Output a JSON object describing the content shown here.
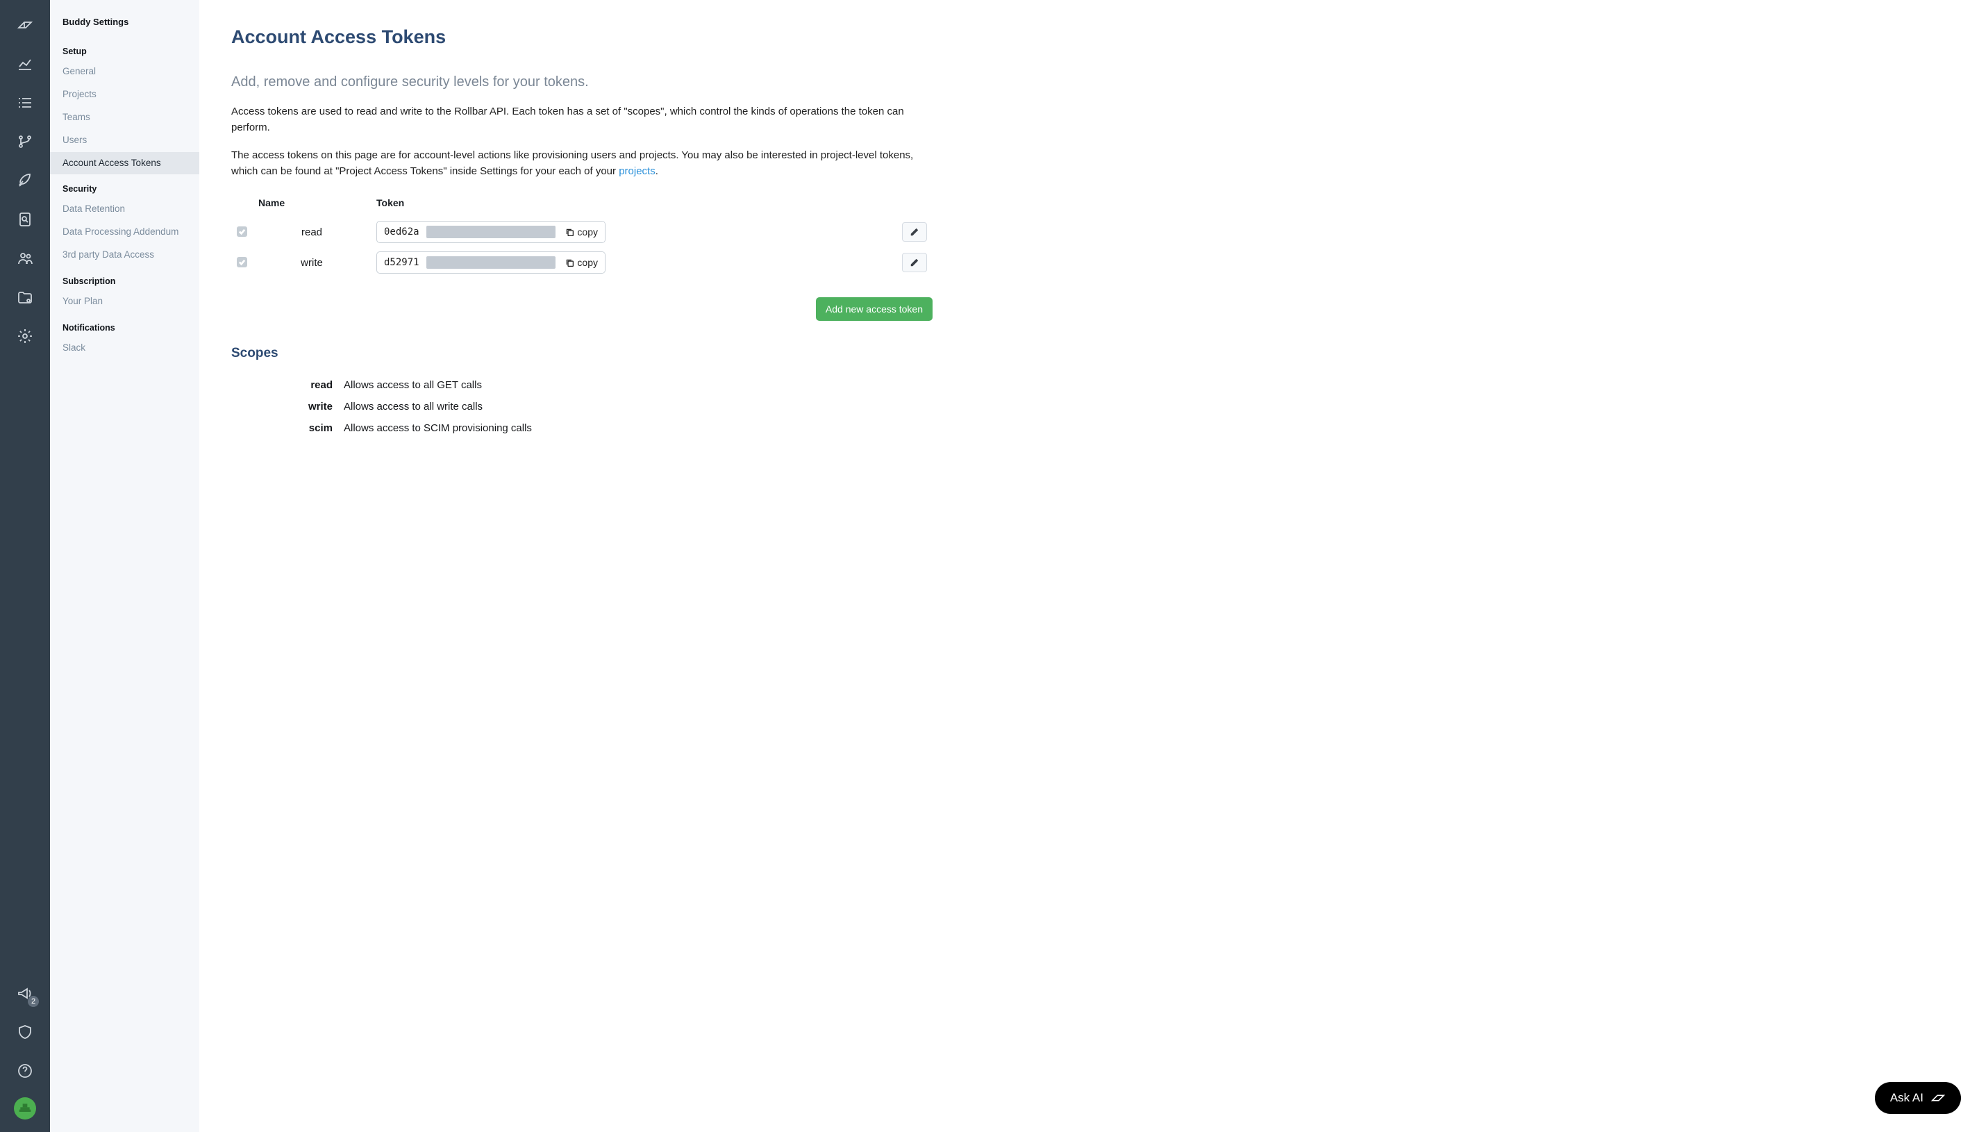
{
  "sidebar": {
    "heading": "Buddy Settings",
    "sections": [
      {
        "label": "Setup",
        "items": [
          "General",
          "Projects",
          "Teams",
          "Users",
          "Account Access Tokens"
        ]
      },
      {
        "label": "Security",
        "items": [
          "Data Retention",
          "Data Processing Addendum",
          "3rd party Data Access"
        ]
      },
      {
        "label": "Subscription",
        "items": [
          "Your Plan"
        ]
      },
      {
        "label": "Notifications",
        "items": [
          "Slack"
        ]
      }
    ],
    "active": "Account Access Tokens"
  },
  "icon_rail": {
    "announce_badge": "2"
  },
  "main": {
    "title": "Account Access Tokens",
    "subtitle": "Add, remove and configure security levels for your tokens.",
    "para1": "Access tokens are used to read and write to the Rollbar API. Each token has a set of \"scopes\", which control the kinds of operations the token can perform.",
    "para2a": "The access tokens on this page are for account-level actions like provisioning users and projects. You may also be interested in project-level tokens, which can be found at \"Project Access Tokens\" inside Settings for your each of your ",
    "para2_link": "projects",
    "para2b": ".",
    "table": {
      "headers": {
        "name": "Name",
        "token": "Token"
      },
      "rows": [
        {
          "name": "read",
          "token": "0ed62a",
          "copy": "copy"
        },
        {
          "name": "write",
          "token": "d52971",
          "copy": "copy"
        }
      ]
    },
    "add_button": "Add new access token",
    "scopes_title": "Scopes",
    "scopes": [
      {
        "name": "read",
        "desc": "Allows access to all GET calls"
      },
      {
        "name": "write",
        "desc": "Allows access to all write calls"
      },
      {
        "name": "scim",
        "desc": "Allows access to SCIM provisioning calls"
      }
    ]
  },
  "ask_ai": {
    "label": "Ask AI"
  }
}
